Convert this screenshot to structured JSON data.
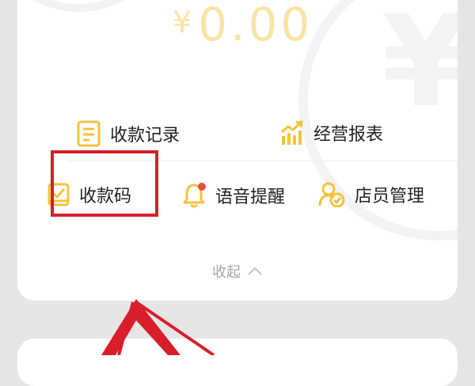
{
  "balance": {
    "currency_symbol": "¥",
    "amount": "0.00"
  },
  "menu": {
    "row1": [
      {
        "label": "收款记录",
        "icon": "receipt-record-icon"
      },
      {
        "label": "经营报表",
        "icon": "bar-chart-trend-icon"
      }
    ],
    "row2": [
      {
        "label": "收款码",
        "icon": "payment-code-icon"
      },
      {
        "label": "语音提醒",
        "icon": "bell-notification-icon"
      },
      {
        "label": "店员管理",
        "icon": "staff-management-icon"
      }
    ]
  },
  "collapse": {
    "label": "收起",
    "icon": "chevron-up-icon"
  },
  "colors": {
    "accent_gold": "#f5c33b",
    "amount_text": "#fbe3a5",
    "highlight_red": "#d81e2b",
    "badge_red": "#e84c3d",
    "muted_text": "#a6a6a6"
  }
}
